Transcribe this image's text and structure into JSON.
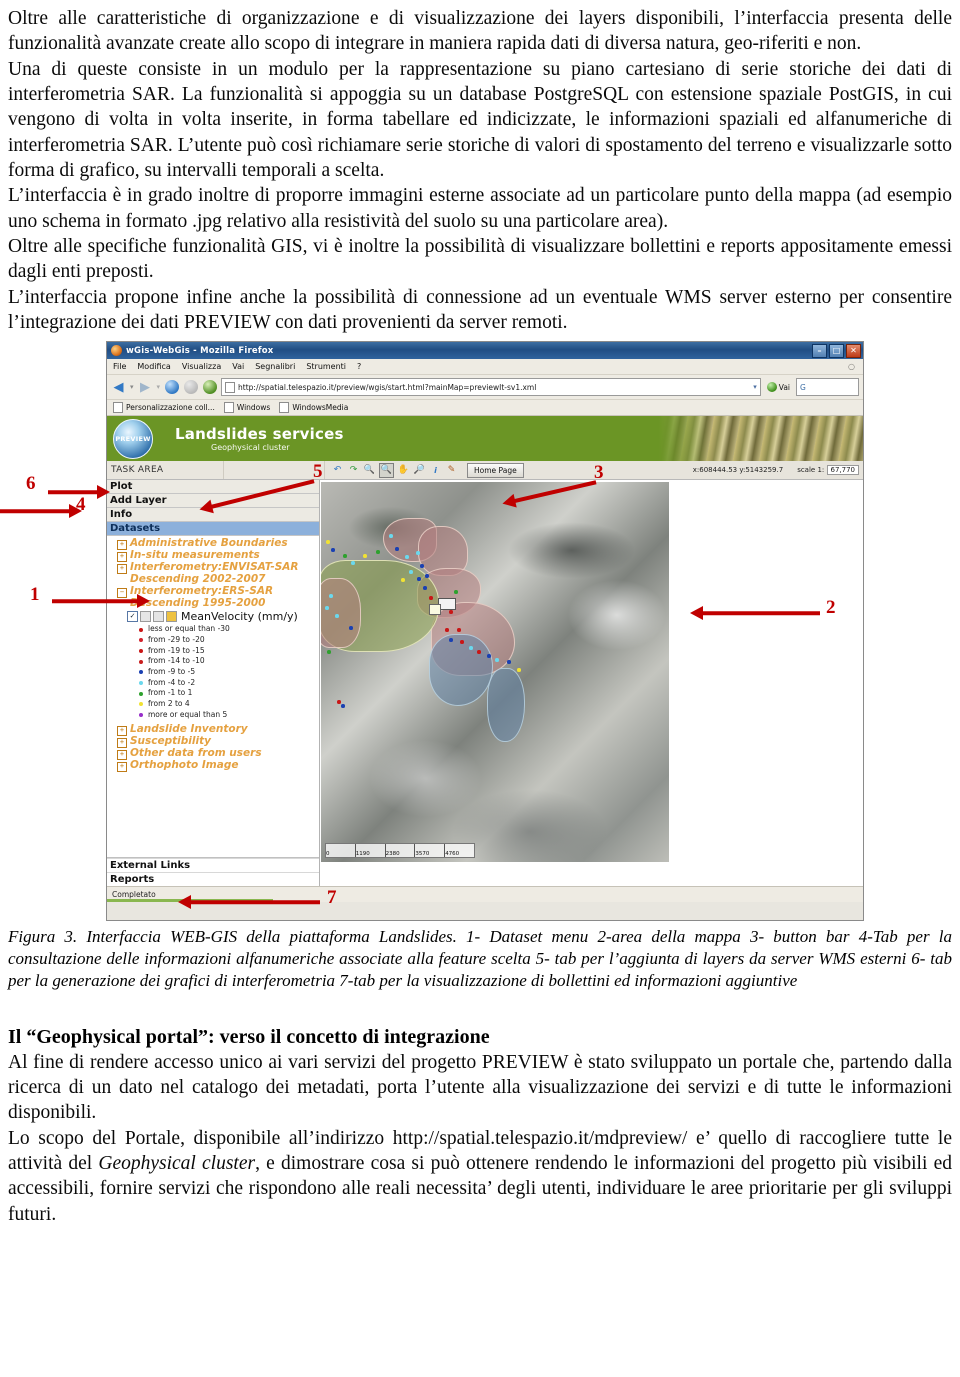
{
  "document": {
    "paragraphs": [
      "Oltre alle caratteristiche di organizzazione e di visualizzazione dei layers disponibili, l’interfaccia presenta delle funzionalità avanzate create allo scopo di integrare in maniera rapida dati di diversa natura, geo-riferiti e non.",
      "Una di queste consiste in un modulo per la rappresentazione su piano cartesiano di serie storiche dei dati di interferometria SAR. La funzionalità si appoggia su un database PostgreSQL con estensione spaziale PostGIS, in cui vengono di volta in volta inserite, in forma tabellare ed indicizzate, le informazioni spaziali ed alfanumeriche di interferometria SAR. L’utente può così richiamare serie storiche di valori di spostamento del terreno e visualizzarle sotto forma di grafico, su intervalli temporali a scelta.",
      "L’interfaccia è in grado inoltre di proporre immagini esterne associate ad un particolare punto della mappa (ad esempio uno schema in formato .jpg relativo alla resistività del suolo su una particolare area).",
      "Oltre alle specifiche funzionalità GIS, vi è inoltre la possibilità di visualizzare bollettini e reports appositamente emessi dagli enti preposti.",
      "L’interfaccia propone infine anche la possibilità di connessione ad un eventuale WMS server esterno per consentire l’integrazione dei dati PREVIEW con dati provenienti da server remoti."
    ],
    "caption": "Figura 3. Interfaccia WEB-GIS della piattaforma Landslides. 1- Dataset menu 2-area della mappa 3- button bar 4-Tab per la consultazione delle informazioni alfanumeriche associate alla feature scelta 5- tab per l’aggiunta di layers da server WMS esterni 6- tab per la generazione dei grafici di interferometria  7-tab per la visualizzazione di bollettini ed informazioni aggiuntive",
    "section_heading": "Il “Geophysical portal”: verso il concetto di integrazione",
    "section_paragraphs": [
      "Al fine di rendere accesso unico ai vari  servizi del progetto PREVIEW è stato sviluppato un portale che, partendo dalla ricerca di un dato nel catalogo dei metadati, porta l’utente alla visualizzazione dei servizi e di tutte le informazioni disponibili."
    ],
    "last_paragraph": {
      "part1": "Lo scopo del Portale, disponibile all’indirizzo http://spatial.telespazio.it/mdpreview/ e’ quello di raccogliere tutte le attività del ",
      "italic": "Geophysical cluster",
      "part2": ", e dimostrare cosa si può ottenere rendendo le informazioni del progetto più visibili ed accessibili, fornire servizi che rispondono alle reali necessita’ degli utenti, individuare le aree prioritarie per gli sviluppi futuri."
    }
  },
  "figure": {
    "browser": {
      "window_title": "wGis-WebGis - Mozilla Firefox",
      "window_buttons": {
        "minimize": "–",
        "maximize": "□",
        "close": "✕"
      },
      "menu_items": [
        "File",
        "Modifica",
        "Visualizza",
        "Vai",
        "Segnalibri",
        "Strumenti",
        "?"
      ],
      "nav": {
        "back": "◀",
        "forward": "▶",
        "reload_icon": "reload-icon",
        "stop_icon": "stop-icon",
        "home_icon": "home-icon",
        "url": "http://spatial.telespazio.it/preview/wgis/start.html?mainMap=previewIt-sv1.xml",
        "dropdown": "▾",
        "go_label": "Vai",
        "search_value": "G"
      },
      "bookmarks": [
        "Personalizzazione coll...",
        "Windows",
        "WindowsMedia"
      ],
      "status_text": "Completato"
    },
    "app": {
      "logo_text": "PREVIEW",
      "banner_title": "Landslides services",
      "banner_subtitle": "Geophysical cluster",
      "task_area_label": "TASK AREA",
      "toolbar_icons": [
        "undo-icon",
        "redo-icon",
        "zoom-in-icon",
        "zoom-out-icon",
        "pan-hand-icon",
        "zoom-full-extent-icon",
        "identify-icon",
        "measure-pencil-icon"
      ],
      "home_button_label": "Home Page",
      "coordinates": "x:608444.53 y:5143259.7",
      "scale_label": "scale 1:",
      "scale_value": "67,770",
      "tabs": [
        "Plot",
        "Add Layer",
        "Info"
      ],
      "datasets_tab": "Datasets",
      "bottom_tabs": [
        "External Links",
        "Reports"
      ],
      "tree_groups": [
        {
          "label": "Administrative Boundaries",
          "expanded": false
        },
        {
          "label": "In-situ measurements",
          "expanded": false
        },
        {
          "label": "Interferometry:ENVISAT-SAR Descending 2002-2007",
          "expanded": false
        },
        {
          "label": "Interferometry:ERS-SAR Descending 1995-2000",
          "expanded": true
        }
      ],
      "active_layer": {
        "name": "MeanVelocity (mm/y)",
        "checked": true,
        "legend": [
          {
            "label": "less or equal than -30",
            "color": "#d01414"
          },
          {
            "label": "from -29 to -20",
            "color": "#d9202b"
          },
          {
            "label": "from -19 to -15",
            "color": "#d01414"
          },
          {
            "label": "from -14 to -10",
            "color": "#cf1d1d"
          },
          {
            "label": "from -9 to -5",
            "color": "#1840b8"
          },
          {
            "label": "from -4 to -2",
            "color": "#66d9ef"
          },
          {
            "label": "from -1 to 1",
            "color": "#2aa32a"
          },
          {
            "label": "from 2 to 4",
            "color": "#f2e32a"
          },
          {
            "label": "more or equal than 5",
            "color": "#9b2ccf"
          }
        ]
      },
      "tree_groups_bottom": [
        {
          "label": "Landslide Inventory"
        },
        {
          "label": "Susceptibility"
        },
        {
          "label": "Other data from users"
        },
        {
          "label": "Orthophoto Image"
        }
      ],
      "map_scalebar": [
        "0",
        "1190",
        "2380",
        "3570",
        "4760"
      ]
    },
    "annotations": [
      {
        "number": "1",
        "target": "dataset-menu"
      },
      {
        "number": "2",
        "target": "map-area"
      },
      {
        "number": "3",
        "target": "button-bar"
      },
      {
        "number": "4",
        "target": "info-tab"
      },
      {
        "number": "5",
        "target": "add-layer-tab"
      },
      {
        "number": "6",
        "target": "plot-tab"
      },
      {
        "number": "7",
        "target": "reports-tab"
      }
    ]
  },
  "colors": {
    "annotation_red": "#c00000",
    "banner_green": "#6a9620",
    "tree_orange": "#E8A13A",
    "selected_blue": "#8ab0dd"
  }
}
